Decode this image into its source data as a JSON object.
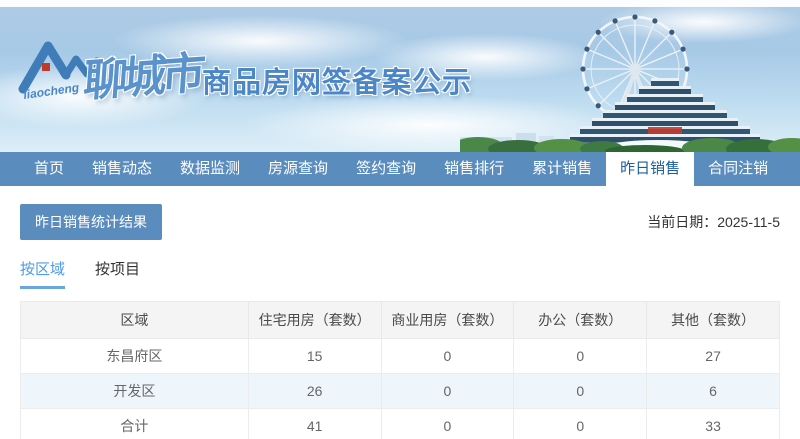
{
  "banner": {
    "logo": {
      "wordmark": "liaocheng"
    },
    "city_calligraphy": "聊城市",
    "title": "商品房网签备案公示"
  },
  "nav": {
    "items": [
      {
        "label": "首页"
      },
      {
        "label": "销售动态"
      },
      {
        "label": "数据监测"
      },
      {
        "label": "房源查询"
      },
      {
        "label": "签约查询"
      },
      {
        "label": "销售排行"
      },
      {
        "label": "累计销售"
      },
      {
        "label": "昨日销售",
        "active": true
      },
      {
        "label": "合同注销"
      }
    ]
  },
  "toolbar": {
    "stats_button_label": "昨日销售统计结果",
    "date_label": "当前日期：",
    "date_value": "2025-11-5"
  },
  "view_tabs": [
    {
      "label": "按区域",
      "active": true
    },
    {
      "label": "按项目",
      "active": false
    }
  ],
  "table": {
    "columns": [
      "区域",
      "住宅用房（套数）",
      "商业用房（套数）",
      "办公（套数）",
      "其他（套数）"
    ],
    "rows": [
      {
        "cells": [
          "东昌府区",
          "15",
          "0",
          "0",
          "27"
        ]
      },
      {
        "cells": [
          "开发区",
          "26",
          "0",
          "0",
          "6"
        ]
      },
      {
        "cells": [
          "合计",
          "41",
          "0",
          "0",
          "33"
        ]
      }
    ]
  },
  "colors": {
    "nav_blue": "#5b8cbe",
    "active_tab_text": "#1b5e9e",
    "title_blue": "#4a86c8",
    "view_tab_accent": "#4d9ce8",
    "stripe_row_bg": "#eef5fb",
    "table_header_bg": "#f4f4f5",
    "logo_red": "#c0392b"
  }
}
